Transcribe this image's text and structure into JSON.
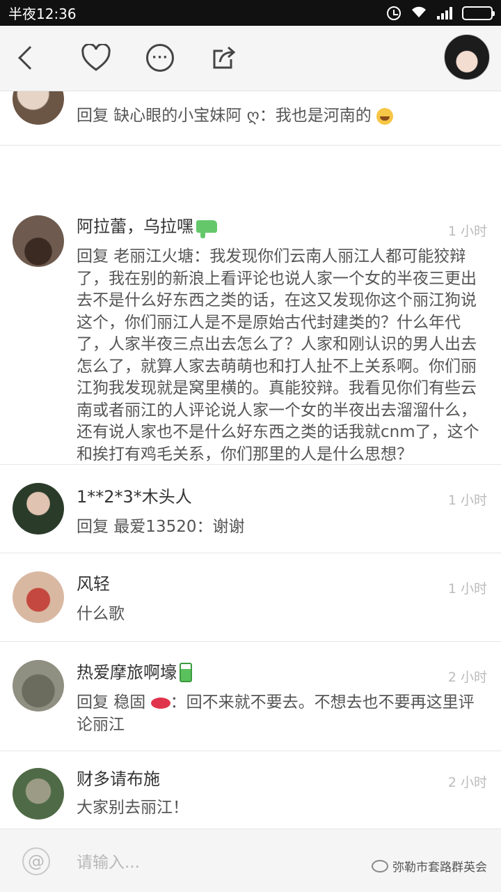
{
  "status_bar": {
    "time": "半夜12:36"
  },
  "icons": {
    "wifi": "wifi-icon",
    "signal": "signal-icon"
  },
  "comments": [
    {
      "text": "回复 缺心眼的小宝妹阿 ღ：我也是河南的"
    },
    {
      "name": "阿拉蕾，乌拉嘿",
      "time": "1 小时",
      "text": "回复 老丽江火塘：我发现你们云南人丽江人都可能狡辩了，我在别的新浪上看评论也说人家一个女的半夜三更出去不是什么好东西之类的话，在这又发现你这个丽江狗说这个，你们丽江人是不是原始古代封建类的？什么年代了，人家半夜三点出去怎么了？人家和刚认识的男人出去怎么了，就算人家去萌萌也和打人扯不上关系啊。你们丽江狗我发现就是窝里横的。真能狡辩。我看见你们有些云南或者丽江的人评论说人家一个女的半夜出去溜溜什么，还有说人家也不是什么好东西之类的话我就cnm了，这个和挨打有鸡毛关系，你们那里的人是什么思想？"
    },
    {
      "name": "1**2*3*木头人",
      "time": "1 小时",
      "text": "回复 最爱13520：谢谢"
    },
    {
      "name": "风轻",
      "time": "1 小时",
      "text": "什么歌"
    },
    {
      "name": "热爱摩旅啊壕",
      "time": "2 小时",
      "text_a": "回复 稳固",
      "text_b": "：回不来就不要去。不想去也不要再这里评论丽江"
    },
    {
      "name": "财多请布施",
      "time": "2 小时",
      "text": "大家别去丽江！"
    }
  ],
  "input": {
    "placeholder": "请输入..."
  },
  "watermark": "弥勒市套路群英会"
}
